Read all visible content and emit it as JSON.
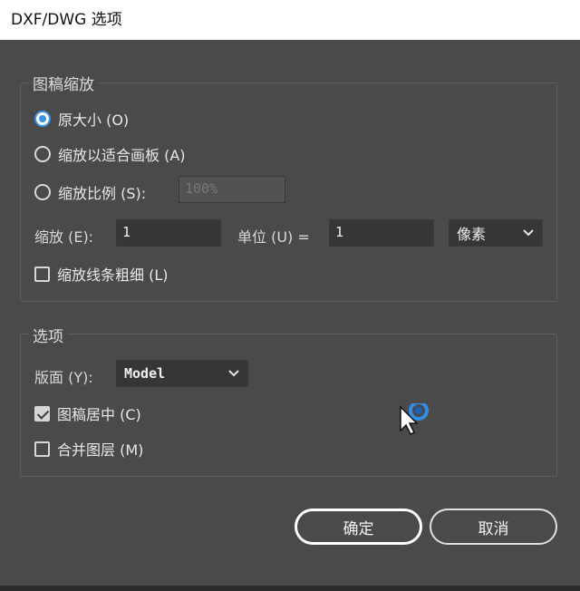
{
  "window": {
    "title": "DXF/DWG 选项"
  },
  "scaling_group": {
    "legend": "图稿缩放",
    "radio_original": "原大小 (O)",
    "radio_fit": "缩放以适合画板 (A)",
    "radio_ratio": "缩放比例 (S):",
    "ratio_value": "100%",
    "scale_label": "缩放 (E):",
    "scale_value": "1",
    "unit_label": "单位 (U) =",
    "unit_value": "1",
    "unit_select": "像素",
    "scale_lines": "缩放线条粗细 (L)"
  },
  "options_group": {
    "legend": "选项",
    "layout_label": "版面 (Y):",
    "layout_select": "Model",
    "center_artwork": "图稿居中 (C)",
    "merge_layers": "合并图层 (M)"
  },
  "buttons": {
    "ok": "确定",
    "cancel": "取消"
  },
  "colors": {
    "accent": "#3b93e8",
    "background": "#4a4a4a"
  }
}
